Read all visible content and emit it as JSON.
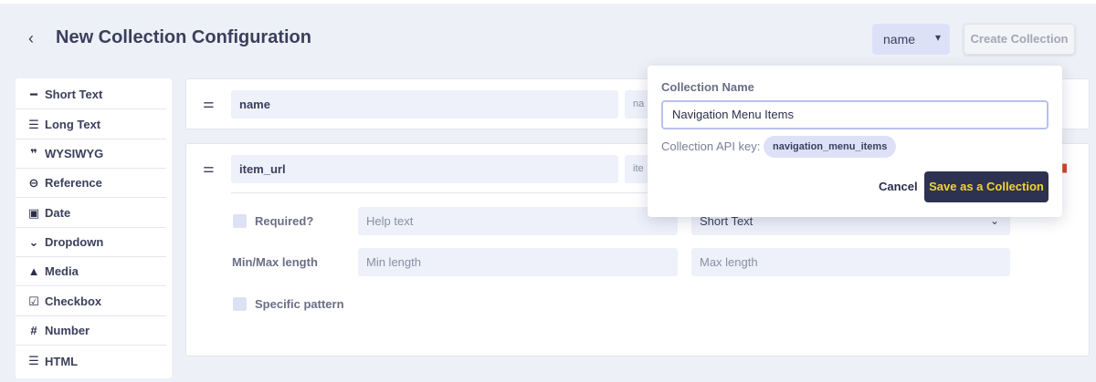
{
  "header": {
    "back_icon": "chevron-left-icon",
    "title": "New Collection Configuration",
    "display_field": "name",
    "create_label": "Create Collection"
  },
  "sidebar": {
    "items": [
      {
        "label": "Short Text",
        "icon": "short-text-icon"
      },
      {
        "label": "Long Text",
        "icon": "long-text-icon"
      },
      {
        "label": "WYSIWYG",
        "icon": "quote-icon"
      },
      {
        "label": "Reference",
        "icon": "link-icon"
      },
      {
        "label": "Date",
        "icon": "calendar-icon"
      },
      {
        "label": "Dropdown",
        "icon": "chevron-down-icon"
      },
      {
        "label": "Media",
        "icon": "image-icon"
      },
      {
        "label": "Checkbox",
        "icon": "checkbox-icon"
      },
      {
        "label": "Number",
        "icon": "hash-icon"
      },
      {
        "label": "HTML",
        "icon": "list-icon"
      }
    ]
  },
  "fields": {
    "field1": {
      "name": "name",
      "key": "na"
    },
    "field2": {
      "name": "item_url",
      "key": "ite",
      "required_label": "Required?",
      "help_placeholder": "Help text",
      "type_value": "Short Text",
      "minmax_label": "Min/Max length",
      "min_placeholder": "Min length",
      "max_placeholder": "Max length",
      "pattern_label": "Specific pattern"
    }
  },
  "popup": {
    "title": "Collection Name",
    "name_value": "Navigation Menu Items",
    "api_label": "Collection API key:",
    "api_key": "navigation_menu_items",
    "cancel_label": "Cancel",
    "save_label": "Save as a Collection"
  },
  "colors": {
    "background": "#eef0f7",
    "accent_dark": "#2c3250",
    "accent_yellow": "#f2d331",
    "chip": "#dde1f8",
    "delete": "#d9412b"
  }
}
